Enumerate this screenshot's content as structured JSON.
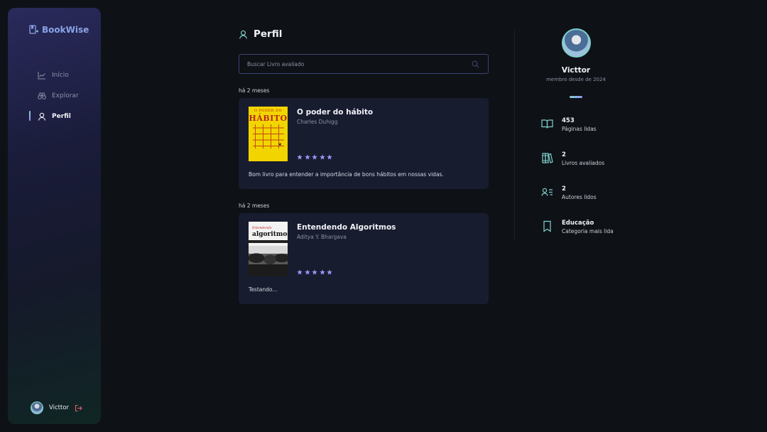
{
  "app": {
    "name": "BookWise"
  },
  "sidebar": {
    "items": [
      {
        "label": "Início",
        "icon": "chart-line-icon"
      },
      {
        "label": "Explorar",
        "icon": "binoculars-icon"
      },
      {
        "label": "Perfil",
        "icon": "user-icon",
        "active": true
      }
    ],
    "user": {
      "name": "Victtor"
    }
  },
  "main": {
    "title": "Perfil",
    "search": {
      "placeholder": "Buscar Livro avaliado",
      "value": ""
    },
    "reviews": [
      {
        "time": "há 2 meses",
        "title": "O poder do hábito",
        "author": "Charles Duhigg",
        "rating": 5,
        "review": "Bom livro para entender a importância de bons hábitos em nossas vidas.",
        "cover_text": [
          "O PODER DO",
          "HÁBITO"
        ]
      },
      {
        "time": "há 2 meses",
        "title": "Entendendo Algoritmos",
        "author": "Aditya Y. Bhargava",
        "rating": 5,
        "review": "Testando...",
        "cover_text": [
          "Entendendo",
          "algoritmos"
        ]
      }
    ]
  },
  "profile": {
    "name": "Victtor",
    "member_since": "membro desde de 2024",
    "stats": [
      {
        "value": "453",
        "label": "Páginas lidas",
        "icon": "book-open-icon"
      },
      {
        "value": "2",
        "label": "Livros avaliados",
        "icon": "books-icon"
      },
      {
        "value": "2",
        "label": "Autores lidos",
        "icon": "user-list-icon"
      },
      {
        "value": "Educação",
        "label": "Categoria mais lida",
        "icon": "bookmark-icon"
      }
    ]
  },
  "colors": {
    "background": "#0e1116",
    "card": "#181c2f",
    "accent_teal": "#7fd1cc",
    "accent_purple": "#9694f5",
    "logout": "#e35d6a"
  }
}
